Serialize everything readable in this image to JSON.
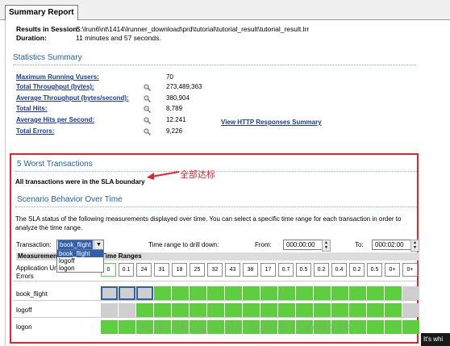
{
  "tab": {
    "label": "Summary Report"
  },
  "session": {
    "results_label": "Results in Session:",
    "results_value": "S:\\lrun6\\nt\\1414\\lrunner_download\\prd\\tutorial\\tutorial_result\\tutorial_result.lrr",
    "duration_label": "Duration:",
    "duration_value": "11 minutes and 57 seconds."
  },
  "statistics": {
    "title": "Statistics Summary",
    "rows": [
      {
        "label": "Maximum Running Vusers:",
        "value": "70",
        "icon": ""
      },
      {
        "label": "Total Throughput (bytes):",
        "value": "273,489,363",
        "icon": "magnifier-icon"
      },
      {
        "label": "Average Throughput (bytes/second):",
        "value": "380,904",
        "icon": "magnifier-icon"
      },
      {
        "label": "Total Hits:",
        "value": "8,789",
        "icon": "magnifier-icon"
      },
      {
        "label": "Average Hits per Second:",
        "value": "12.241",
        "icon": "magnifier-icon"
      },
      {
        "label": "Total Errors:",
        "value": "9,226",
        "icon": "magnifier-icon"
      }
    ],
    "http_link": "View HTTP Responses Summary"
  },
  "worst": {
    "title": "5 Worst Transactions",
    "sla_text": "All transactions were in the SLA boundary",
    "annotation": "全部达标"
  },
  "scenario": {
    "title": "Scenario Behavior Over Time",
    "description": "The SLA status of the following measurements displayed over time. You can select a specific time range for each transaction in order to analyze the time range.",
    "transaction_label": "Transaction:",
    "transaction_selected": "book_flight",
    "transaction_options": [
      "book_flight",
      "logoff",
      "logon"
    ],
    "range_label": "Time range to drill down:",
    "from_label": "From:",
    "from_value": "000:00:00",
    "to_label": "To:",
    "to_value": "000:02:00",
    "col_measurement": "Measurement",
    "col_ranges": "Time Ranges",
    "errors_label": "Application Under Test Errors",
    "error_values": [
      "0",
      "0.1",
      "24",
      "31",
      "18",
      "25",
      "32",
      "43",
      "38",
      "17",
      "0.7",
      "0.5",
      "0.2",
      "0.4",
      "0.2",
      "0.5",
      "0+",
      "0+"
    ],
    "rows": [
      {
        "name": "book_flight",
        "status": [
          "gray",
          "gray",
          "gray",
          "green",
          "green",
          "green",
          "green",
          "green",
          "green",
          "green",
          "green",
          "green",
          "green",
          "green",
          "green",
          "green",
          "green",
          "gray"
        ]
      },
      {
        "name": "logoff",
        "status": [
          "gray",
          "gray",
          "green",
          "green",
          "green",
          "green",
          "green",
          "green",
          "green",
          "green",
          "green",
          "green",
          "green",
          "green",
          "green",
          "green",
          "green",
          "gray"
        ]
      },
      {
        "name": "logon",
        "status": [
          "green",
          "green",
          "green",
          "green",
          "green",
          "green",
          "green",
          "green",
          "green",
          "green",
          "green",
          "green",
          "green",
          "green",
          "green",
          "green",
          "green",
          "green"
        ]
      }
    ]
  },
  "colors": {
    "accent": "#2060a8",
    "pass": "#5dcf3f",
    "nodata": "#cfcfcf",
    "highlight": "#e8212b"
  },
  "watermark": "http://blog.csdn.net/u011460428",
  "corner_text": "It's whi"
}
